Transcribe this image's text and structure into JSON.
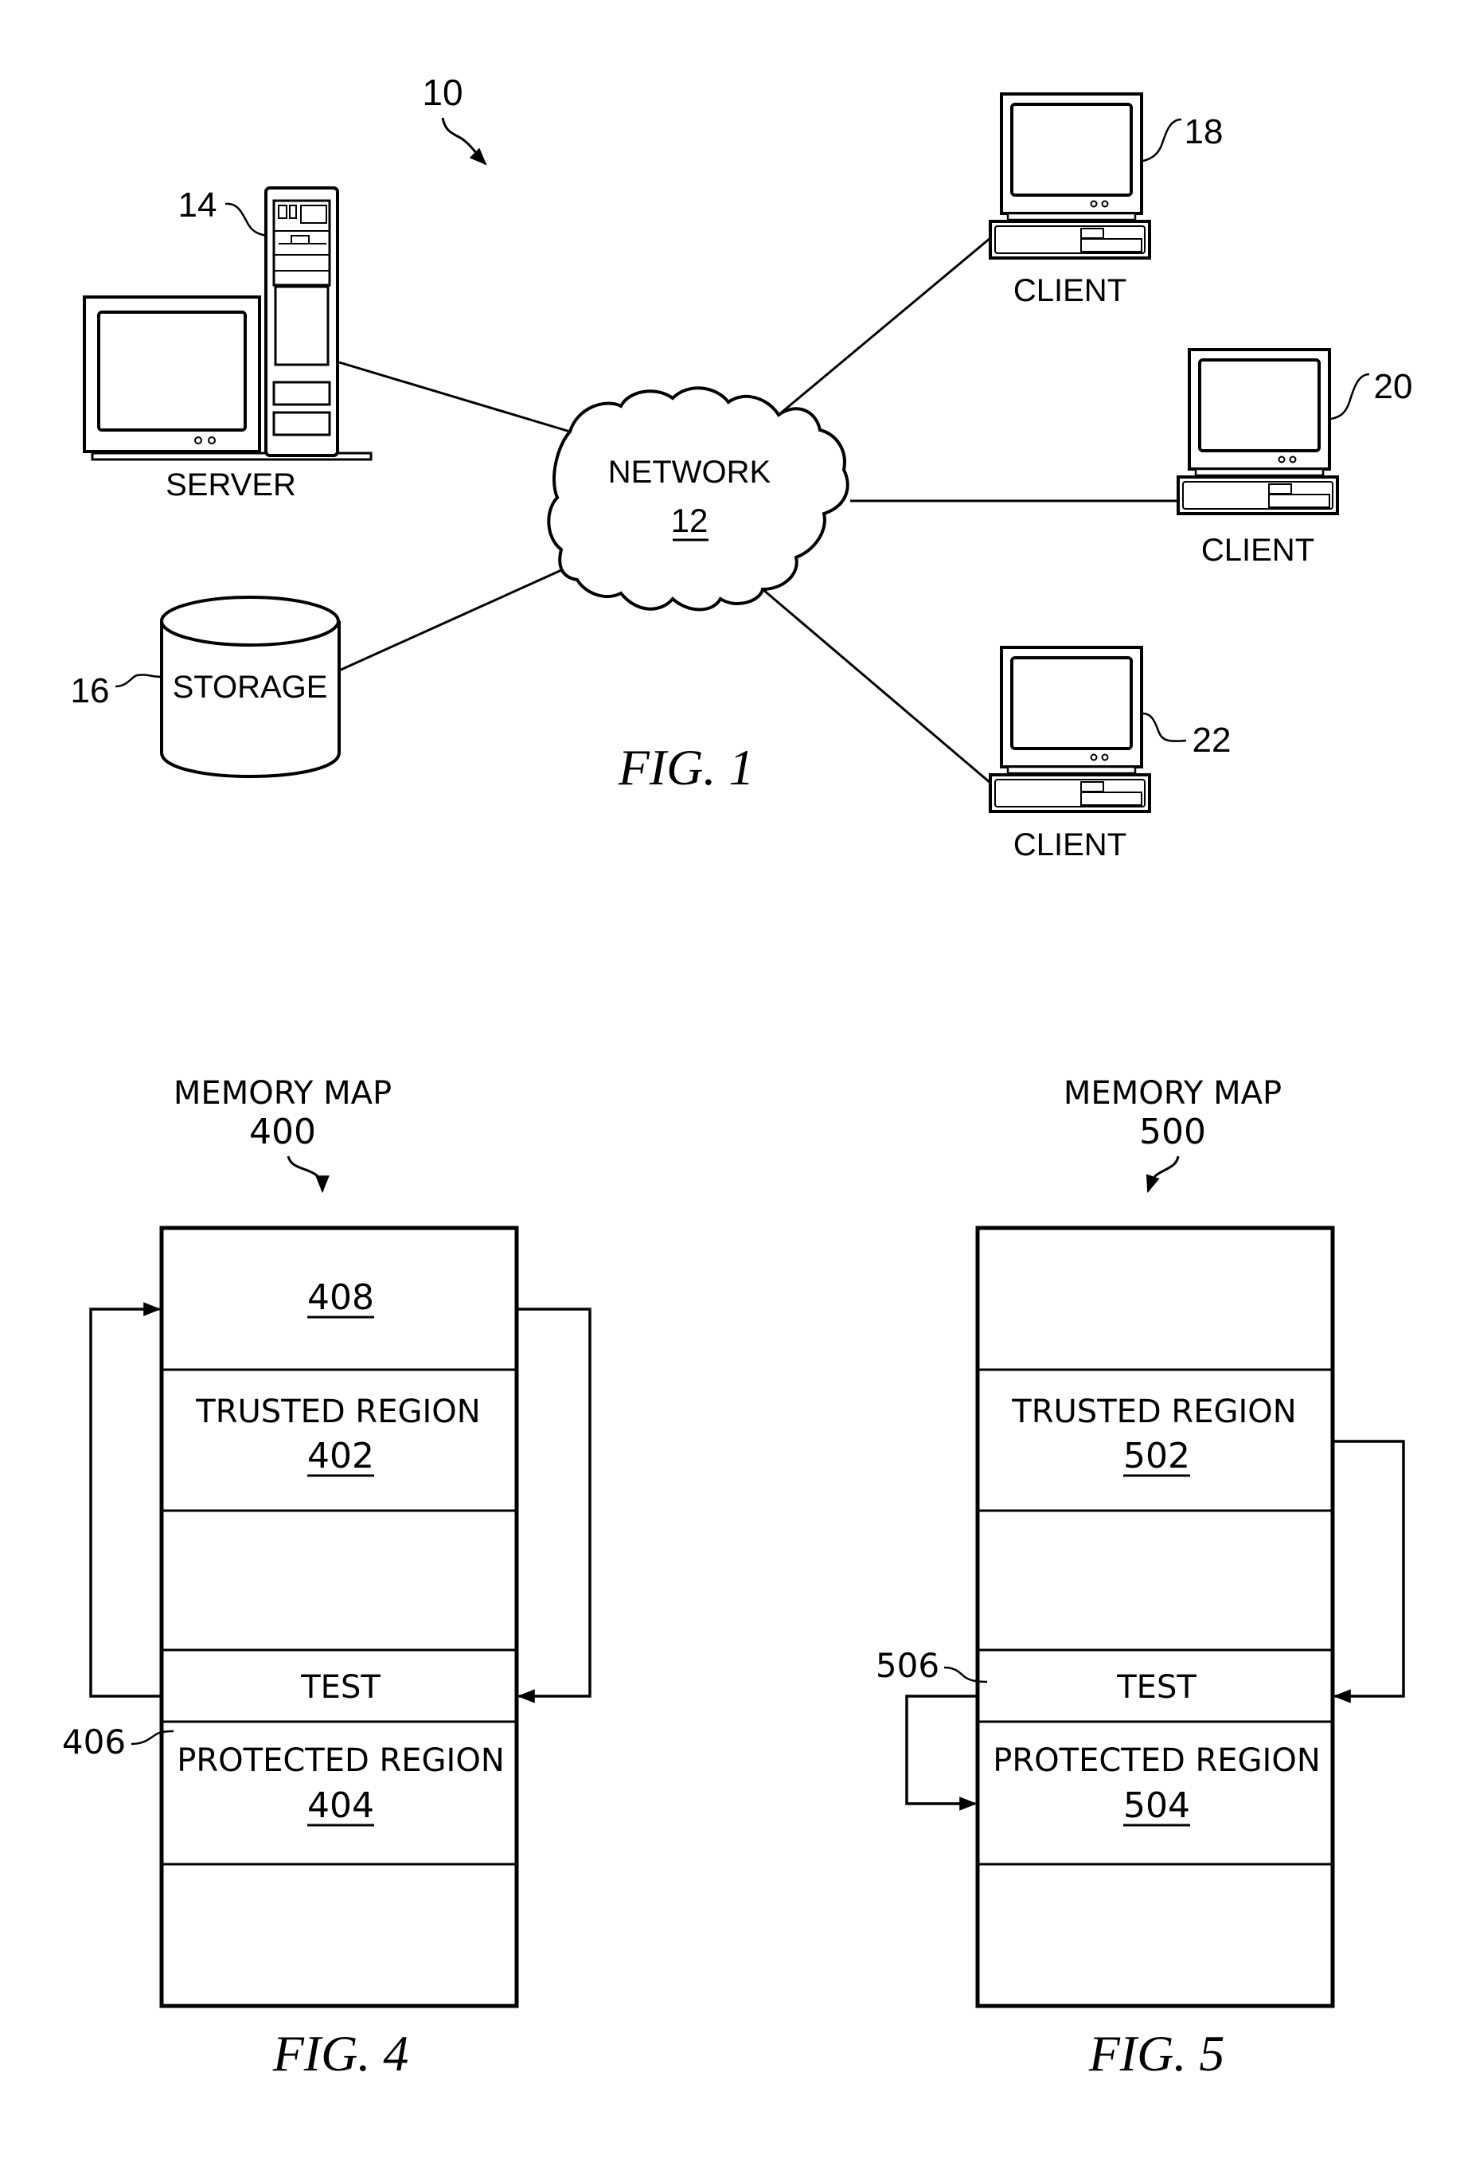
{
  "page": {
    "type": "patent drawing sheet",
    "background_color": "#ffffff",
    "ink_color": "#000000"
  },
  "fig1": {
    "caption": "FIG. 1",
    "system_ref": "10",
    "network": {
      "label": "NETWORK",
      "ref": "12"
    },
    "server": {
      "label": "SERVER",
      "ref": "14"
    },
    "storage": {
      "label": "STORAGE",
      "ref": "16"
    },
    "clients": [
      {
        "label": "CLIENT",
        "ref": "18"
      },
      {
        "label": "CLIENT",
        "ref": "20"
      },
      {
        "label": "CLIENT",
        "ref": "22"
      }
    ],
    "connections": [
      {
        "from": "SERVER",
        "to": "NETWORK"
      },
      {
        "from": "STORAGE",
        "to": "NETWORK"
      },
      {
        "from": "NETWORK",
        "to": "CLIENT 18"
      },
      {
        "from": "NETWORK",
        "to": "CLIENT 20"
      },
      {
        "from": "NETWORK",
        "to": "CLIENT 22"
      }
    ]
  },
  "fig4": {
    "caption": "FIG. 4",
    "title": "MEMORY MAP",
    "ref": "400",
    "rows": [
      {
        "label": "",
        "ref": "408"
      },
      {
        "label": "TRUSTED REGION",
        "ref": "402"
      },
      {
        "label": "",
        "ref": ""
      },
      {
        "label": "TEST",
        "ref": ""
      },
      {
        "label": "PROTECTED REGION",
        "ref": "404"
      },
      {
        "label": "",
        "ref": ""
      }
    ],
    "test_ref": "406",
    "arrows": [
      {
        "from": "TEST",
        "to": "408",
        "side": "left"
      },
      {
        "from": "408",
        "to": "TEST",
        "side": "right"
      }
    ]
  },
  "fig5": {
    "caption": "FIG. 5",
    "title": "MEMORY MAP",
    "ref": "500",
    "rows": [
      {
        "label": "",
        "ref": ""
      },
      {
        "label": "TRUSTED REGION",
        "ref": "502"
      },
      {
        "label": "",
        "ref": ""
      },
      {
        "label": "TEST",
        "ref": ""
      },
      {
        "label": "PROTECTED REGION",
        "ref": "504"
      },
      {
        "label": "",
        "ref": ""
      }
    ],
    "test_ref": "506",
    "arrows": [
      {
        "from": "TRUSTED REGION 502",
        "to": "TEST",
        "side": "right"
      },
      {
        "from": "TEST",
        "to": "PROTECTED REGION 504",
        "side": "left"
      }
    ]
  }
}
